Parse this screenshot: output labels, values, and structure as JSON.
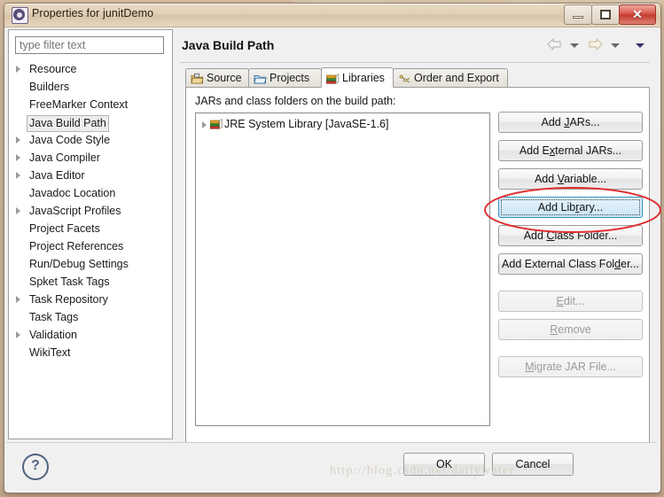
{
  "window": {
    "title": "Properties for junitDemo",
    "app_icon": "eclipse-gear-icon",
    "controls": {
      "minimize": "minimize-icon",
      "maximize": "restore-icon",
      "close": "✕"
    }
  },
  "sidebar": {
    "filter": {
      "placeholder": "type filter text",
      "value": ""
    },
    "items": [
      {
        "label": "Resource",
        "expandable": true,
        "selected": false
      },
      {
        "label": "Builders",
        "expandable": false,
        "selected": false
      },
      {
        "label": "FreeMarker Context",
        "expandable": false,
        "selected": false
      },
      {
        "label": "Java Build Path",
        "expandable": false,
        "selected": true
      },
      {
        "label": "Java Code Style",
        "expandable": true,
        "selected": false
      },
      {
        "label": "Java Compiler",
        "expandable": true,
        "selected": false
      },
      {
        "label": "Java Editor",
        "expandable": true,
        "selected": false
      },
      {
        "label": "Javadoc Location",
        "expandable": false,
        "selected": false
      },
      {
        "label": "JavaScript Profiles",
        "expandable": true,
        "selected": false
      },
      {
        "label": "Project Facets",
        "expandable": false,
        "selected": false
      },
      {
        "label": "Project References",
        "expandable": false,
        "selected": false
      },
      {
        "label": "Run/Debug Settings",
        "expandable": false,
        "selected": false
      },
      {
        "label": "Spket Task Tags",
        "expandable": false,
        "selected": false
      },
      {
        "label": "Task Repository",
        "expandable": true,
        "selected": false
      },
      {
        "label": "Task Tags",
        "expandable": false,
        "selected": false
      },
      {
        "label": "Validation",
        "expandable": true,
        "selected": false
      },
      {
        "label": "WikiText",
        "expandable": false,
        "selected": false
      }
    ]
  },
  "page": {
    "title": "Java Build Path",
    "nav": {
      "back": "back-arrow-icon",
      "back_menu": "chevron-down-icon",
      "forward": "forward-arrow-icon",
      "forward_menu": "chevron-down-icon",
      "view_menu": "chevron-down-icon"
    },
    "tabs": [
      {
        "label": "Source",
        "icon": "source-folder-icon",
        "active": false
      },
      {
        "label": "Projects",
        "icon": "projects-folder-icon",
        "active": false
      },
      {
        "label": "Libraries",
        "icon": "libraries-books-icon",
        "active": true
      },
      {
        "label": "Order and Export",
        "icon": "order-export-icon",
        "active": false
      }
    ],
    "panel_label": "JARs and class folders on the build path:",
    "tree": [
      {
        "label": "JRE System Library [JavaSE-1.6]",
        "icon": "jre-library-icon",
        "expandable": true
      }
    ],
    "buttons": [
      {
        "id": "add-jars",
        "pre": "Add ",
        "mnemonic": "J",
        "post": "ARs...",
        "state": "normal"
      },
      {
        "id": "add-external-jars",
        "pre": "Add E",
        "mnemonic": "x",
        "post": "ternal JARs...",
        "state": "normal"
      },
      {
        "id": "add-variable",
        "pre": "Add ",
        "mnemonic": "V",
        "post": "ariable...",
        "state": "normal"
      },
      {
        "id": "add-library",
        "pre": "Add Lib",
        "mnemonic": "r",
        "post": "ary...",
        "state": "focused"
      },
      {
        "id": "add-class-folder",
        "pre": "Add ",
        "mnemonic": "C",
        "post": "lass Folder...",
        "state": "normal"
      },
      {
        "id": "add-external-class-folder",
        "pre": "Add External Class Fol",
        "mnemonic": "d",
        "post": "er...",
        "state": "normal"
      },
      {
        "id": "edit",
        "pre": "",
        "mnemonic": "E",
        "post": "dit...",
        "state": "disabled",
        "gap_before": true
      },
      {
        "id": "remove",
        "pre": "",
        "mnemonic": "R",
        "post": "emove",
        "state": "disabled"
      },
      {
        "id": "migrate-jar-file",
        "pre": "",
        "mnemonic": "M",
        "post": "igrate JAR File...",
        "state": "disabled",
        "gap_before": true
      }
    ]
  },
  "footer": {
    "help": "?",
    "ok": "OK",
    "cancel": "Cancel"
  },
  "annotation": {
    "shape": "red-ellipse",
    "color": "#e03030",
    "target": "add-library"
  },
  "watermark": "http://blog.csdn.net/dailywater"
}
